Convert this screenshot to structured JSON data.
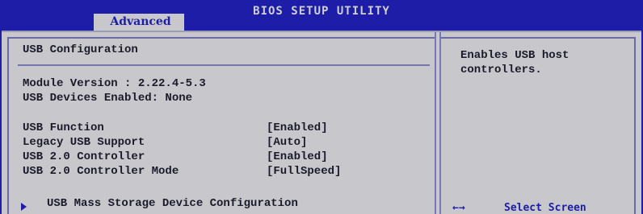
{
  "header": {
    "title": "BIOS SETUP UTILITY",
    "active_tab": "Advanced"
  },
  "main": {
    "section_title": "USB Configuration",
    "module_version": "Module Version : 2.22.4-5.3",
    "devices_enabled": "USB Devices Enabled: None",
    "settings": [
      {
        "label": "USB Function",
        "value": "[Enabled]"
      },
      {
        "label": "Legacy USB Support",
        "value": "[Auto]"
      },
      {
        "label": "USB 2.0 Controller",
        "value": "[Enabled]"
      },
      {
        "label": "USB 2.0 Controller Mode",
        "value": "[FullSpeed]"
      }
    ],
    "submenu_label": "USB Mass Storage Device Configuration"
  },
  "help": {
    "text": "Enables USB host\ncontrollers.",
    "key_glyph": "←→",
    "key_desc": "Select Screen"
  },
  "colors": {
    "bios_blue": "#1d1da8",
    "panel_gray": "#c8c8cc",
    "text_dark": "#1a1a2a"
  }
}
